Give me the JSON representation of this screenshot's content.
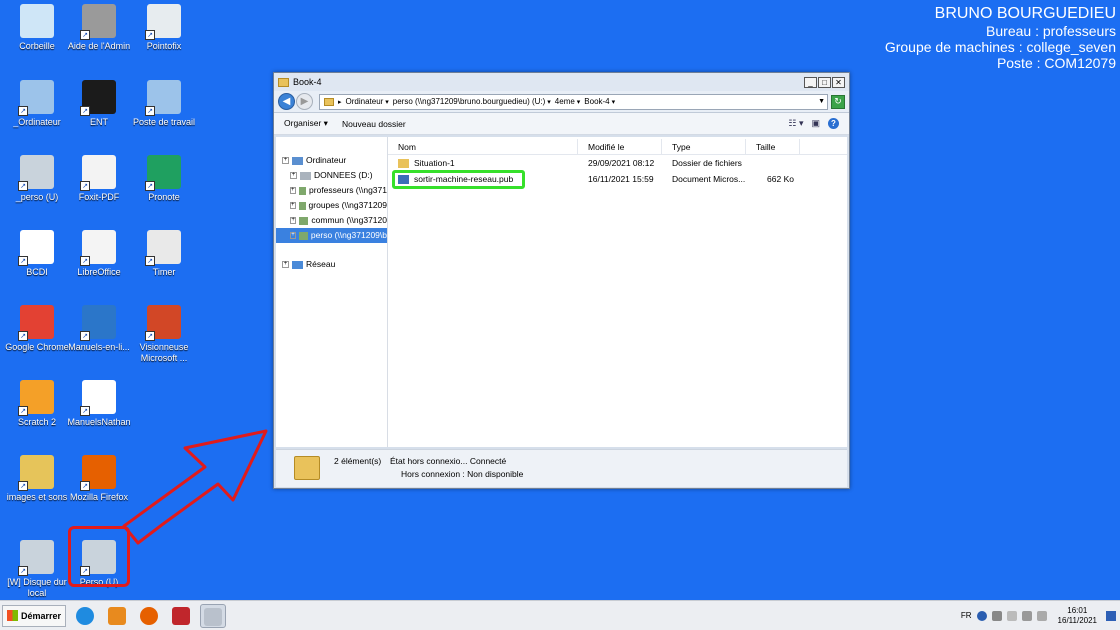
{
  "desktop": {
    "icons": [
      {
        "label": "Corbeille",
        "icon": "recycle-bin-icon",
        "color": "#cfe6f7"
      },
      {
        "label": "Aide de l'Admin",
        "icon": "keyboard-icon",
        "color": "#9a9a9a"
      },
      {
        "label": "Pointofix",
        "icon": "pointofix-icon",
        "color": "#e7ecef"
      },
      {
        "label": "_Ordinateur",
        "icon": "computer-icon",
        "color": "#9cc3ea"
      },
      {
        "label": "ENT",
        "icon": "ent-icon",
        "color": "#1b1b1b"
      },
      {
        "label": "Poste de travail",
        "icon": "workstation-icon",
        "color": "#9cc3ea"
      },
      {
        "label": "_perso (U)",
        "icon": "network-drive-icon",
        "color": "#c9d3dc"
      },
      {
        "label": "Foxit-PDF",
        "icon": "foxit-pdf-icon",
        "color": "#f3f3f3"
      },
      {
        "label": "Pronote",
        "icon": "pronote-icon",
        "color": "#1fa060"
      },
      {
        "label": "BCDI",
        "icon": "bcdi-icon",
        "color": "#ffffff"
      },
      {
        "label": "LibreOffice",
        "icon": "libreoffice-icon",
        "color": "#f4f4f4"
      },
      {
        "label": "Timer",
        "icon": "clock-icon",
        "color": "#e9e9e9"
      },
      {
        "label": "Google Chrome",
        "icon": "chrome-icon",
        "color": "#e34133"
      },
      {
        "label": "Manuels-en-li...",
        "icon": "manuels-icon",
        "color": "#2b76c9"
      },
      {
        "label": "Visionneuse Microsoft ...",
        "icon": "powerpoint-viewer-icon",
        "color": "#d24726"
      },
      {
        "label": "Scratch 2",
        "icon": "scratch-icon",
        "color": "#f4a028"
      },
      {
        "label": "ManuelsNathan",
        "icon": "biblio-manuels-icon",
        "color": "#ffffff"
      },
      {
        "label": "images et sons",
        "icon": "folder-media-icon",
        "color": "#e6c45a"
      },
      {
        "label": "Mozilla Firefox",
        "icon": "firefox-icon",
        "color": "#e66000"
      },
      {
        "label": "[W] Disque dur local",
        "icon": "hard-drive-icon",
        "color": "#c9d3dc"
      },
      {
        "label": "Perso (U)",
        "icon": "network-drive-icon",
        "color": "#c9d3dc"
      }
    ]
  },
  "userinfo": {
    "name": "BRUNO BOURGUEDIEU",
    "bureau": "Bureau : professeurs",
    "groupe": "Groupe de machines : college_seven",
    "poste": "Poste : COM12079"
  },
  "window": {
    "title": "Book-4",
    "address": [
      "Ordinateur",
      "perso (\\\\ng371209\\bruno.bourguedieu) (U:)",
      "4eme",
      "Book-4"
    ],
    "toolbar": {
      "organize": "Organiser ▾",
      "new_folder": "Nouveau dossier"
    },
    "tree": [
      {
        "label": "Ordinateur",
        "icon": "computer-icon",
        "indent": 0
      },
      {
        "label": "DONNEES (D:)",
        "icon": "drive-icon",
        "indent": 1
      },
      {
        "label": "professeurs (\\\\ng371",
        "icon": "network-drive-icon",
        "indent": 1
      },
      {
        "label": "groupes (\\\\ng371209",
        "icon": "network-drive-icon",
        "indent": 1
      },
      {
        "label": "commun (\\\\ng37120",
        "icon": "network-drive-icon",
        "indent": 1
      },
      {
        "label": "perso (\\\\ng371209\\b",
        "icon": "network-drive-icon",
        "indent": 1,
        "selected": true
      },
      {
        "label": "Réseau",
        "icon": "network-icon",
        "indent": 0
      }
    ],
    "columns": [
      "Nom",
      "Modifié le",
      "Type",
      "Taille"
    ],
    "files": [
      {
        "name": "Situation-1",
        "modified": "29/09/2021 08:12",
        "type": "Dossier de fichiers",
        "size": "",
        "icon": "folder-icon"
      },
      {
        "name": "sortir-machine-reseau.pub",
        "modified": "16/11/2021 15:59",
        "type": "Document Micros...",
        "size": "662 Ko",
        "icon": "publisher-file-icon"
      }
    ],
    "status": {
      "count": "2 élément(s)",
      "state_label": "État hors connexio... Connecté",
      "offline_label": "Hors connexion : Non disponible"
    }
  },
  "taskbar": {
    "start": "Démarrer",
    "apps": [
      "ie-icon",
      "media-player-icon",
      "firefox-icon",
      "psp-icon",
      "explorer-drive-icon"
    ],
    "lang": "FR",
    "time": "16:01",
    "date": "16/11/2021"
  }
}
